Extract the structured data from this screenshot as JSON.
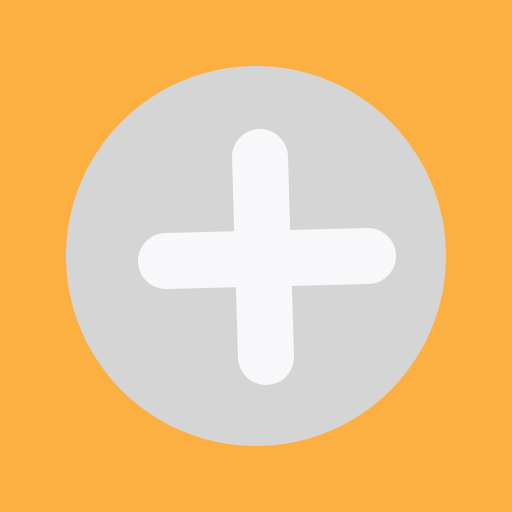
{
  "icon": {
    "name": "plus-icon",
    "colors": {
      "background": "#FCB041",
      "circle": "#D5D5D6",
      "plus": "#F8F8FA"
    }
  }
}
